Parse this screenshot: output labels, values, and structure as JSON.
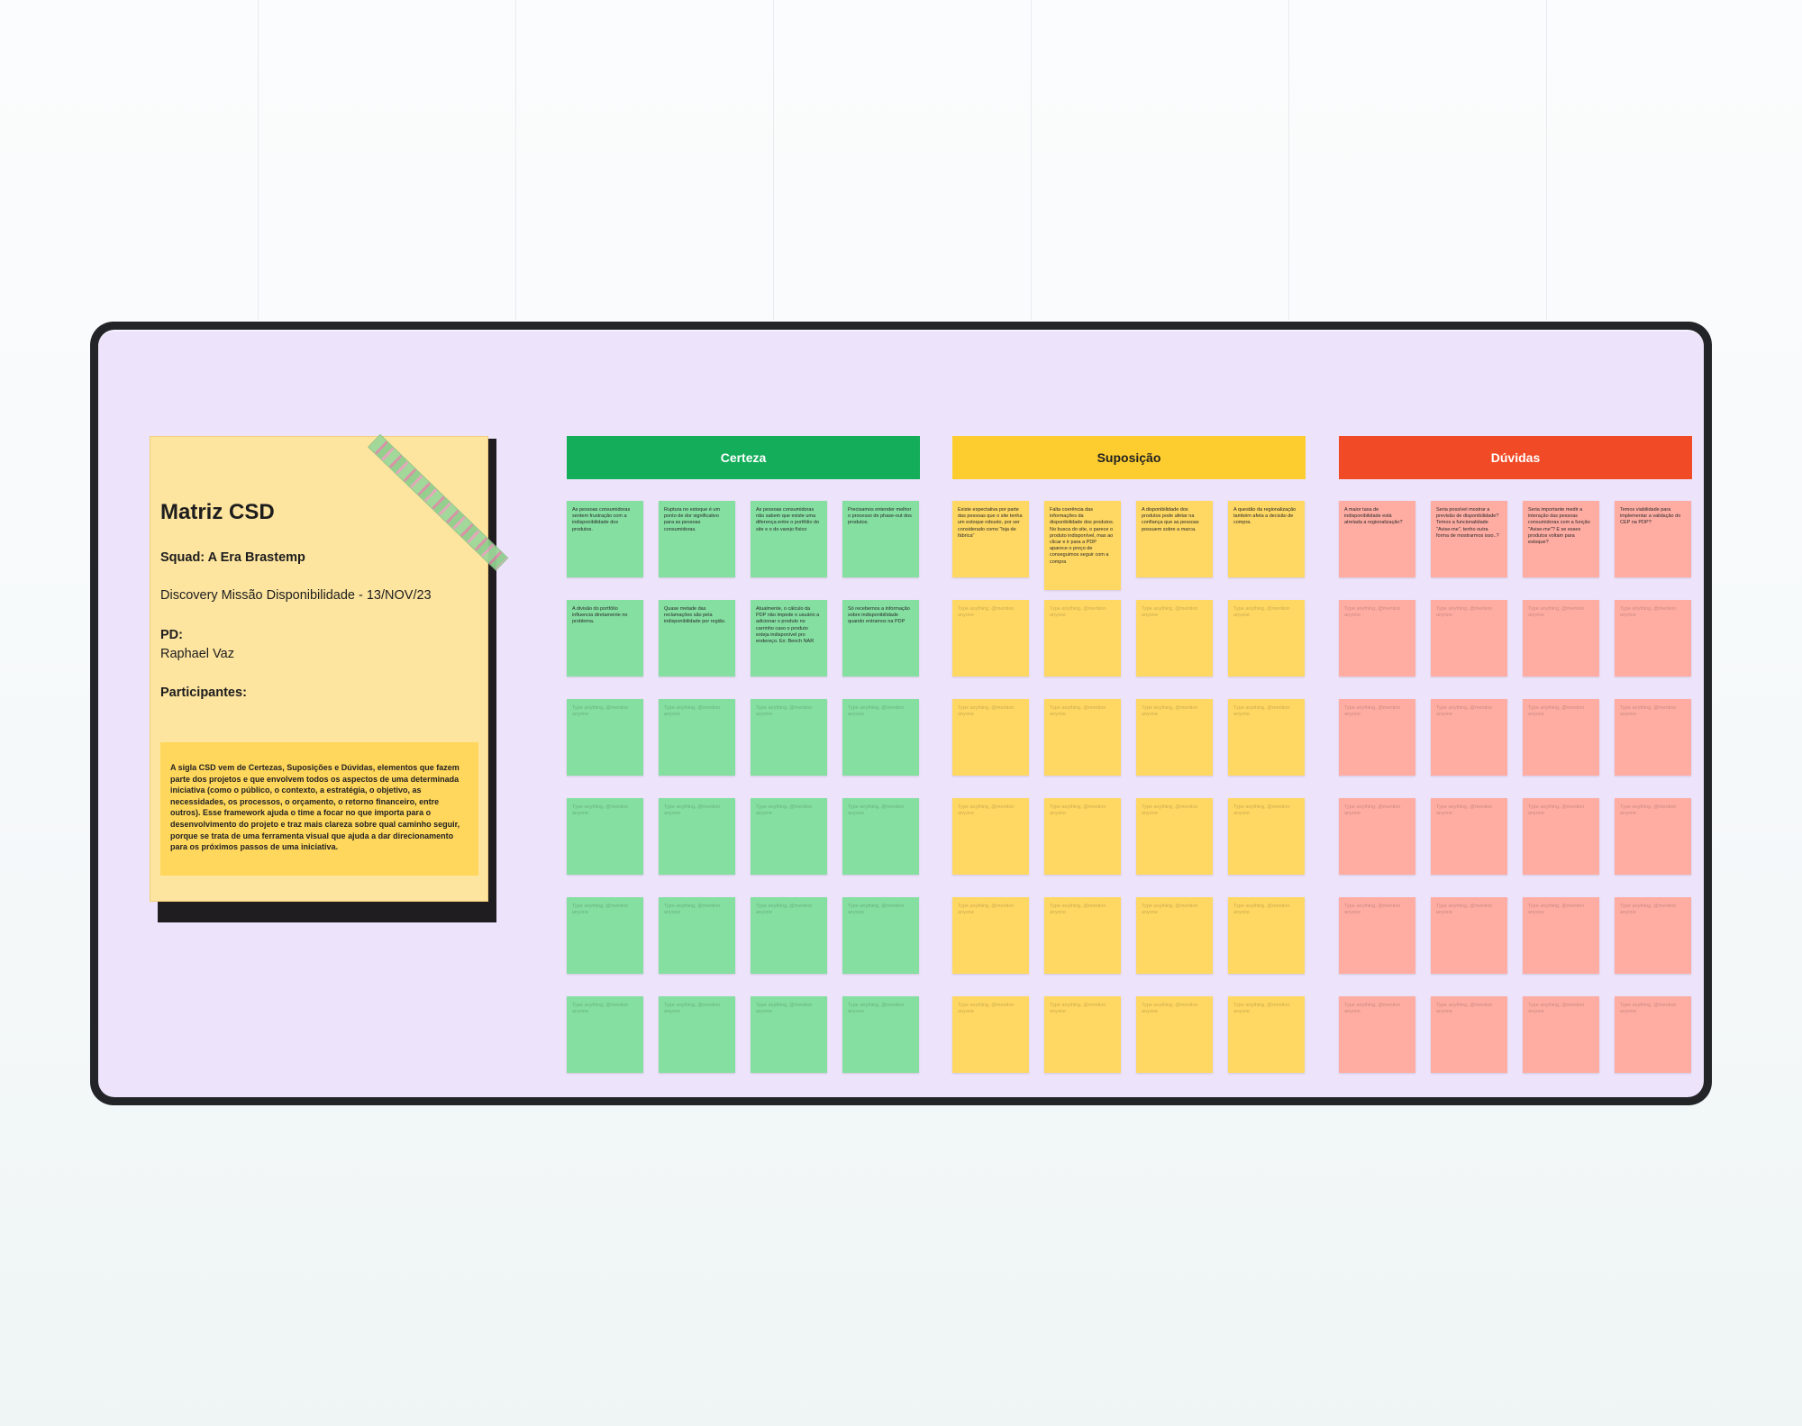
{
  "card": {
    "title": "Matriz CSD",
    "squad": "Squad: A Era Brastemp",
    "discovery": "Discovery Missão Disponibilidade - 13/NOV/23",
    "pd_label": "PD:",
    "pd_name": "Raphael Vaz",
    "participants_label": "Participantes:",
    "description": "A sigla CSD vem de Certezas, Suposições e Dúvidas, elementos que fazem parte dos projetos e que envolvem todos os aspectos de uma determinada iniciativa (como o público, o contexto, a estratégia, o objetivo, as necessidades, os processos, o orçamento, o retorno financeiro, entre outros). Esse framework ajuda o time a focar no que importa para o desenvolvimento do projeto e traz mais clareza sobre qual caminho seguir, porque se trata de uma ferramenta visual que ajuda a dar direcionamento para os próximos passos de uma iniciativa."
  },
  "placeholder": "Type anything, @mention anyone",
  "columns": [
    {
      "title": "Certeza",
      "color": "#14ad5a",
      "note_color": "#85dfa1",
      "notes": [
        "As pessoas consumidoras sentem frustração com a indisponibilidade dos produtos.",
        "Ruptura no estoque é um ponto de dor significativo para as pessoas consumidoras.",
        "As pessoas consumidoras não sabem que existe uma diferença entre o portfólio do site e o do varejo físico",
        "Precisamos entender melhor o processo de phase-out dos produtos.",
        "A divisão do portfólio influencia diretamente no problema.",
        "Quase metade das reclamações são pela indisponibilidade por região.",
        "Atualmente, o cálculo da PDP não impede o usuário a adicionar o produto no carrinho caso o produto esteja indisponível pro endereço. Ex: Bench NAR",
        "Só recebemos a informação sobre indisponibilidade quando entramos na PDP"
      ]
    },
    {
      "title": "Suposição",
      "color": "#fdcd2f",
      "note_color": "#ffd863",
      "notes": [
        "Existe expectativa por parte das pessoas que o site tenha um estoque robusto, por ser considerado como \"loja de fábrica\"",
        "Falta coerência das informações da disponibilidade dos produtos. No busca do site, o parece o produto indisponível, mas ao clicar e ir para a PDP aparece o preço de conseguimos seguir com a compra",
        "A disponibilidade dos produtos pode afetar na confiança que as pessoas possuem sobre a marca.",
        "A questão da regionalização também afeta a decisão de compra."
      ]
    },
    {
      "title": "Dúvidas",
      "color": "#f04b26",
      "note_color": "#ffada3",
      "notes": [
        "A maior taxa de indisponibilidade está atrelada a regionalização?",
        "Seria possível mostrar a previsão de disponibilidade? Temos a funcionalidade \"Avise-me\", tenho outra forma de mostrarmos isso..?",
        "Seria importante medir a interação das pessoas consumidoras com a função \"Avise-me\"? E se esses produtos voltam para estoque?",
        "Temos viabilidade para implementar a validação do CEP na PDP?"
      ]
    }
  ]
}
